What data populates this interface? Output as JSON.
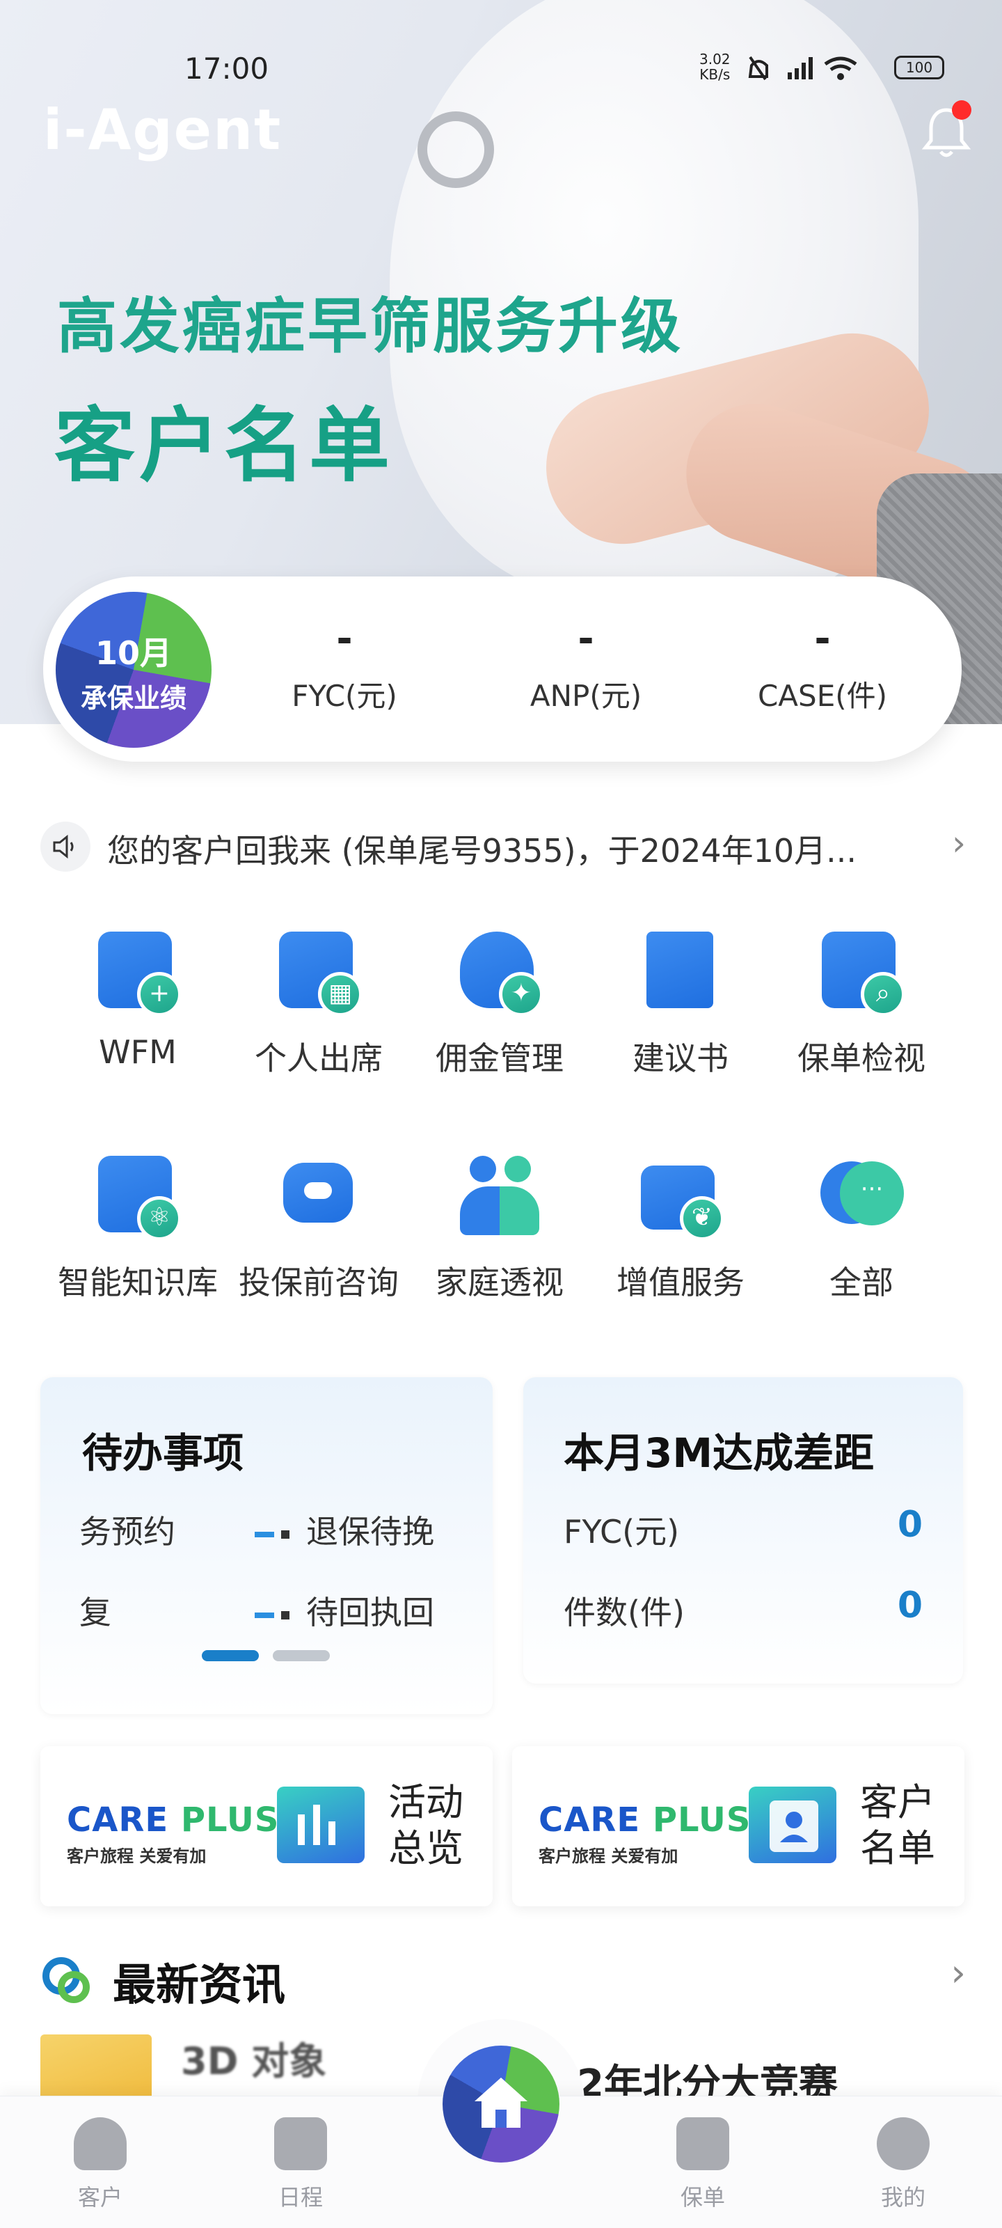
{
  "status_bar": {
    "time": "17:00",
    "net_rate": "3.02\nKB/s",
    "icons": "🔕 ᴴᴰ▂▄▆█ ◠",
    "battery": "100"
  },
  "header": {
    "brand": "i-Agent"
  },
  "banner": {
    "line1": "高发癌症早筛服务升级",
    "line2": "客户名单"
  },
  "performance": {
    "badge_line1": "10月",
    "badge_line2": "承保业绩",
    "stats": [
      {
        "value": "-",
        "label": "FYC(元)"
      },
      {
        "value": "-",
        "label": "ANP(元)"
      },
      {
        "value": "-",
        "label": "CASE(件)"
      }
    ]
  },
  "notice": {
    "text": "您的客户回我来 (保单尾号9355)，于2024年10月..."
  },
  "shortcuts": [
    {
      "label": "WFM",
      "icon": "calendar-plus-icon",
      "glyph": "+"
    },
    {
      "label": "个人出席",
      "icon": "calendar-grid-icon",
      "glyph": "▦"
    },
    {
      "label": "佣金管理",
      "icon": "money-bag-icon",
      "glyph": "✦"
    },
    {
      "label": "建议书",
      "icon": "book-icon",
      "glyph": ""
    },
    {
      "label": "保单检视",
      "icon": "clipboard-search-icon",
      "glyph": "⌕"
    },
    {
      "label": "智能知识库",
      "icon": "knowledge-book-icon",
      "glyph": "⚛"
    },
    {
      "label": "投保前咨询",
      "icon": "robot-icon",
      "glyph": ""
    },
    {
      "label": "家庭透视",
      "icon": "family-icon",
      "glyph": ""
    },
    {
      "label": "增值服务",
      "icon": "briefcase-leaf-icon",
      "glyph": "❦"
    },
    {
      "label": "全部",
      "icon": "more-chat-icon",
      "glyph": "···"
    }
  ],
  "todo": {
    "title": "待办事项",
    "rows": [
      {
        "left": "务预约",
        "right": "退保待挽"
      },
      {
        "left": "复",
        "right": "待回执回"
      }
    ]
  },
  "gap": {
    "title": "本月3M达成差距",
    "rows": [
      {
        "label": "FYC(元)",
        "value": "0"
      },
      {
        "label": "件数(件)",
        "value": "0"
      }
    ]
  },
  "promos": [
    {
      "brand_a": "CARE",
      "brand_b": "PLUS",
      "tagline": "客户旅程 关爱有加",
      "line1": "活动",
      "line2": "总览"
    },
    {
      "brand_a": "CARE",
      "brand_b": "PLUS",
      "tagline": "客户旅程 关爱有加",
      "line1": "客户",
      "line2": "名单"
    }
  ],
  "news": {
    "title": "最新资讯",
    "item_left": "3D 对象",
    "item_right": "22年北分大竞赛"
  },
  "bottom_nav": [
    {
      "label": "客户",
      "icon": "customer-icon"
    },
    {
      "label": "日程",
      "icon": "schedule-icon"
    },
    {
      "label": "保单",
      "icon": "policy-icon"
    },
    {
      "label": "我的",
      "icon": "profile-icon"
    }
  ],
  "colors": {
    "accent_blue": "#1f6fe0",
    "accent_green": "#1ea58c",
    "value_blue": "#1a7fc9",
    "alert_red": "#ff2b2b"
  }
}
